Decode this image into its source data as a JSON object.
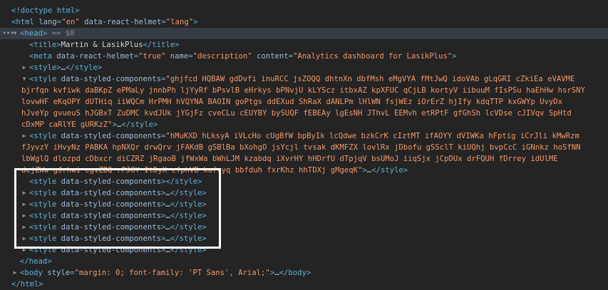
{
  "lines": [
    {
      "indent": 16,
      "tw": null,
      "sel": false,
      "segs": [
        [
          "tag",
          "<!doctype html>"
        ]
      ]
    },
    {
      "indent": 16,
      "tw": null,
      "sel": false,
      "segs": [
        [
          "tag",
          "<html "
        ],
        [
          "attr",
          "lang"
        ],
        [
          "tag",
          "="
        ],
        [
          "val",
          "\"en\""
        ],
        [
          "attr",
          " data-react-helmet"
        ],
        [
          "tag",
          "="
        ],
        [
          "val",
          "\"lang\""
        ],
        [
          "tag",
          ">"
        ]
      ]
    },
    {
      "indent": 28,
      "tw": "▼",
      "sel": true,
      "gutter": "•••",
      "segs": [
        [
          "tag",
          "<head>"
        ],
        [
          "cmt",
          " == $0"
        ]
      ]
    },
    {
      "indent": 41,
      "tw": null,
      "sel": false,
      "segs": [
        [
          "tag",
          "<title>"
        ],
        [
          "txt",
          "Martin & LasikPlus"
        ],
        [
          "tag",
          "</title>"
        ]
      ]
    },
    {
      "indent": 41,
      "tw": null,
      "sel": false,
      "segs": [
        [
          "tag",
          "<meta "
        ],
        [
          "attr",
          "data-react-helmet"
        ],
        [
          "tag",
          "="
        ],
        [
          "val",
          "\"true\""
        ],
        [
          "attr",
          " name"
        ],
        [
          "tag",
          "="
        ],
        [
          "val",
          "\"description\""
        ],
        [
          "attr",
          " content"
        ],
        [
          "tag",
          "="
        ],
        [
          "val",
          "\"Analytics dashboard for LasikPlus\""
        ],
        [
          "tag",
          ">"
        ]
      ]
    },
    {
      "indent": 41,
      "tw": "▶",
      "sel": false,
      "segs": [
        [
          "tag",
          "<style>"
        ],
        [
          "txt",
          "…"
        ],
        [
          "tag",
          "</style>"
        ]
      ]
    },
    {
      "indent": 41,
      "tw": "▼",
      "sel": false,
      "segs": [
        [
          "tag",
          "<style "
        ],
        [
          "attr",
          "data-styled-components"
        ],
        [
          "tag",
          "="
        ],
        [
          "val",
          "\"ghjfcd HQBAW gdDvfi inuRCC jsZOQQ dhtnXn dbfMsh eMgVYA fMtJwQ idoVAb gLqGRI cZkiEa eVAVME"
        ]
      ]
    },
    {
      "indent": 30,
      "tw": null,
      "sel": false,
      "segs": [
        [
          "val",
          "bjrfqn kvfiwk daBKpZ ePMaLy jnnbPh ljYyRf bPsvlB eHrkys bPNvjU kLYScz itbxAZ kpXFUC qCjLB kortyV iibuuM fIsPSu haEhHw hsrSNY"
        ]
      ]
    },
    {
      "indent": 30,
      "tw": null,
      "sel": false,
      "segs": [
        [
          "val",
          "lovwHF eKqOPY dUTHiq iiWQCm HrPMH hVQYNA BAOIN goPtgs ddEXud ShRaX dANLPm lHlWN fsjWEz iOrErZ hjIfy kdqTTP kxGWYp UvyDx"
        ]
      ]
    },
    {
      "indent": 30,
      "tw": null,
      "sel": false,
      "segs": [
        [
          "val",
          "hJveYp gvueuS hJGBxT ZuDMC kvdJUk jYGjFz cveCLu cEUYBY bySUQF fEBEAy lgEsNH JThvL EEMvh etRPtF gfGhSh lcVDse cJIVqv SpHtd"
        ]
      ]
    },
    {
      "indent": 30,
      "tw": null,
      "sel": false,
      "segs": [
        [
          "val",
          "cDxMP caRlYE gURKzZ\""
        ],
        [
          "tag",
          ">"
        ],
        [
          "txt",
          "…"
        ],
        [
          "tag",
          "</style>"
        ]
      ]
    },
    {
      "indent": 41,
      "tw": "▶",
      "sel": false,
      "segs": [
        [
          "tag",
          "<style "
        ],
        [
          "attr",
          "data-styled-components"
        ],
        [
          "tag",
          "="
        ],
        [
          "val",
          "\"hMuKXD hLksyA iVLcHo cUgBfW bpByIk lcQdwe bzkCrK cIztMT ifAOYY dVIWKa hFptig iCrJli kMwRzm"
        ]
      ]
    },
    {
      "indent": 30,
      "tw": null,
      "sel": false,
      "segs": [
        [
          "val",
          "fJyvzY iHvyNz PABKA hpNXQr drwQrv jFAKdB gSBlBa bXohgO jsYcjl tvsak dKMFZX lovlRx jDbofu gSSclT kiUQhj bvpCcC iGNnkz hoSfNN"
        ]
      ]
    },
    {
      "indent": 30,
      "tw": null,
      "sel": false,
      "segs": [
        [
          "val",
          "lbWglQ dlozpd cDbxcr diCZRZ jRgaoB jfWxWa bWhLJM kzabdq iXvrHY hHDrfU dTpjqV bsUMoJ iiqSjx jCpDUx drFQUH fDrrey idUlME"
        ]
      ]
    },
    {
      "indent": 30,
      "tw": null,
      "sel": false,
      "segs": [
        [
          "val",
          "dcjZWw gJrhwi cgvZBQ rPJGY ItDyX cfphVB kufvyq bbfduh fxrKhz hhTDXj gMgeqK\""
        ],
        [
          "tag",
          ">"
        ],
        [
          "txt",
          "…"
        ],
        [
          "tag",
          "</style>"
        ]
      ]
    },
    {
      "indent": 41,
      "tw": null,
      "sel": false,
      "segs": [
        [
          "tag",
          "<style "
        ],
        [
          "attr",
          "data-styled-components"
        ],
        [
          "tag",
          "></style>"
        ]
      ]
    },
    {
      "indent": 41,
      "tw": "▶",
      "sel": false,
      "segs": [
        [
          "tag",
          "<style "
        ],
        [
          "attr",
          "data-styled-components"
        ],
        [
          "tag",
          ">"
        ],
        [
          "txt",
          "…"
        ],
        [
          "tag",
          "</style>"
        ]
      ]
    },
    {
      "indent": 41,
      "tw": "▶",
      "sel": false,
      "segs": [
        [
          "tag",
          "<style "
        ],
        [
          "attr",
          "data-styled-components"
        ],
        [
          "tag",
          ">"
        ],
        [
          "txt",
          "…"
        ],
        [
          "tag",
          "</style>"
        ]
      ]
    },
    {
      "indent": 41,
      "tw": "▶",
      "sel": false,
      "segs": [
        [
          "tag",
          "<style "
        ],
        [
          "attr",
          "data-styled-components"
        ],
        [
          "tag",
          ">"
        ],
        [
          "txt",
          "…"
        ],
        [
          "tag",
          "</style>"
        ]
      ]
    },
    {
      "indent": 41,
      "tw": "▶",
      "sel": false,
      "segs": [
        [
          "tag",
          "<style "
        ],
        [
          "attr",
          "data-styled-components"
        ],
        [
          "tag",
          ">"
        ],
        [
          "txt",
          "…"
        ],
        [
          "tag",
          "</style>"
        ]
      ]
    },
    {
      "indent": 41,
      "tw": "▶",
      "sel": false,
      "segs": [
        [
          "tag",
          "<style "
        ],
        [
          "attr",
          "data-styled-components"
        ],
        [
          "tag",
          ">"
        ],
        [
          "txt",
          "…"
        ],
        [
          "tag",
          "</style>"
        ]
      ]
    },
    {
      "indent": 41,
      "tw": "▶",
      "sel": false,
      "segs": [
        [
          "tag",
          "<style "
        ],
        [
          "attr",
          "data-styled-components"
        ],
        [
          "tag",
          ">"
        ],
        [
          "txt",
          "…"
        ],
        [
          "tag",
          "</style>"
        ]
      ]
    },
    {
      "indent": 28,
      "tw": null,
      "sel": false,
      "segs": [
        [
          "tag",
          "</head>"
        ]
      ]
    },
    {
      "indent": 28,
      "tw": "▶",
      "sel": false,
      "segs": [
        [
          "tag",
          "<body "
        ],
        [
          "attr",
          "style"
        ],
        [
          "tag",
          "="
        ],
        [
          "val",
          "\"margin: 0; font-family: 'PT Sans', Arial;\""
        ],
        [
          "tag",
          ">"
        ],
        [
          "txt",
          "…"
        ],
        [
          "tag",
          "</body>"
        ]
      ]
    },
    {
      "indent": 16,
      "tw": null,
      "sel": false,
      "segs": [
        [
          "tag",
          "</html>"
        ]
      ]
    }
  ]
}
